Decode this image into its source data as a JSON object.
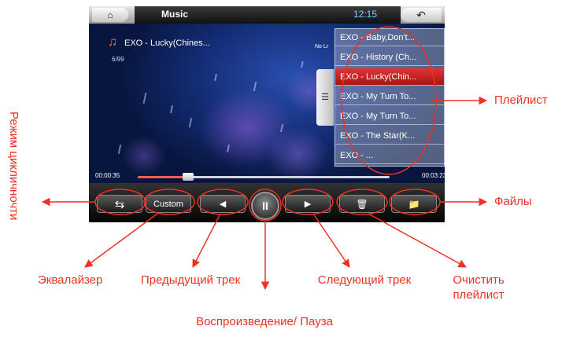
{
  "app": {
    "title": "Music",
    "clock": "12:15",
    "home_icon": "home-icon",
    "back_icon": "back-arrow-icon"
  },
  "track": {
    "title": "EXO - Lucky(Chines...",
    "count": "6/99",
    "lyrics_status": "No Lr"
  },
  "playlist": {
    "items": [
      {
        "label": "EXO - Baby,Don't...",
        "active": false
      },
      {
        "label": "EXO - History (Ch...",
        "active": false
      },
      {
        "label": "EXO - Lucky(Chin...",
        "active": true
      },
      {
        "label": "EXO - My Turn To...",
        "active": false
      },
      {
        "label": "EXO - My Turn To...",
        "active": false
      },
      {
        "label": "EXO - The Star(K...",
        "active": false
      },
      {
        "label": "EXO - ...",
        "active": false
      }
    ]
  },
  "progress": {
    "current": "00:00:35",
    "total": "00:03:23",
    "fraction": 0.19
  },
  "controls": {
    "repeat_icon": "repeat-icon",
    "eq_label": "Custom",
    "prev_icon": "skip-previous-icon",
    "pause_symbol": "II",
    "next_icon": "skip-next-icon",
    "trash_icon": "trash-icon",
    "files_icon": "folder-add-icon"
  },
  "annotations": {
    "playlist": "Плейлист",
    "files": "Файлы",
    "repeat_mode": "Режим цикличночти",
    "equalizer": "Эквалайзер",
    "prev_track": "Предыдущий трек",
    "play_pause": "Воспроизведение/ Пауза",
    "next_track": "Следующий трек",
    "clear_playlist": "Очистить плейлист"
  },
  "colors": {
    "annotation": "#ee3124",
    "accent_red": "#d92828",
    "clock": "#7fd0ff"
  }
}
